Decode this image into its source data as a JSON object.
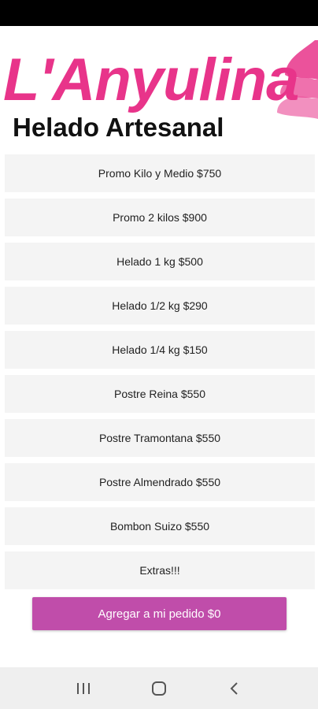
{
  "brand": {
    "name": "L'Anyulina",
    "tagline": "Helado Artesanal",
    "color_pink": "#e8348a",
    "color_dark": "#111111"
  },
  "menu": {
    "items": [
      {
        "label": "Promo Kilo y Medio $750"
      },
      {
        "label": "Promo 2 kilos $900"
      },
      {
        "label": "Helado 1 kg $500"
      },
      {
        "label": "Helado 1/2 kg $290"
      },
      {
        "label": "Helado 1/4 kg $150"
      },
      {
        "label": "Postre Reina $550"
      },
      {
        "label": "Postre Tramontana $550"
      },
      {
        "label": "Postre Almendrado $550"
      },
      {
        "label": "Bombon Suizo $550"
      },
      {
        "label": "Extras!!!"
      }
    ]
  },
  "order": {
    "button_label": "Agregar a mi pedido $0",
    "color": "#c04daa"
  },
  "navbar": {
    "recents_icon": "recents-icon",
    "home_icon": "home-icon",
    "back_icon": "back-icon"
  }
}
